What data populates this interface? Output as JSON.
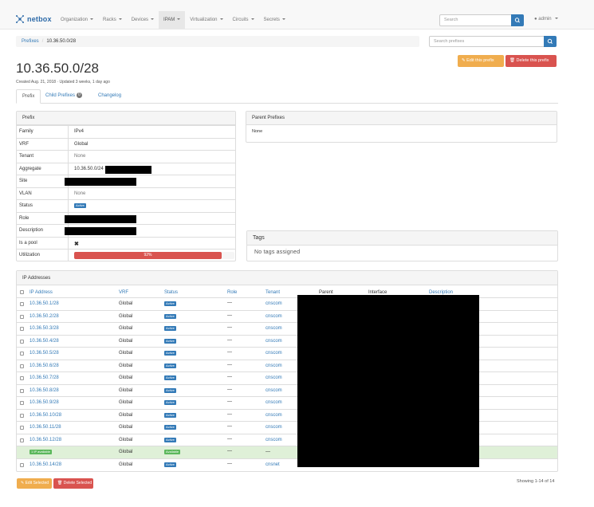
{
  "brand": {
    "name": "netbox"
  },
  "nav": {
    "items": [
      {
        "label": "Organization",
        "active": false
      },
      {
        "label": "Racks",
        "active": false
      },
      {
        "label": "Devices",
        "active": false
      },
      {
        "label": "IPAM",
        "active": true
      },
      {
        "label": "Virtualization",
        "active": false
      },
      {
        "label": "Circuits",
        "active": false
      },
      {
        "label": "Secrets",
        "active": false
      }
    ],
    "search_placeholder": "Search",
    "user": "admin"
  },
  "breadcrumb": {
    "parent": "Prefixes",
    "current": "10.36.50.0/28"
  },
  "prefix_search_placeholder": "Search prefixes",
  "actions": {
    "edit": "Edit this prefix",
    "delete": "Delete this prefix"
  },
  "title": "10.36.50.0/28",
  "created_text": "Created Aug. 21, 2018 · Updated 3 weeks, 1 day ago",
  "tabs": [
    {
      "label": "Prefix",
      "active": true
    },
    {
      "label": "Child Prefixes",
      "badge": "0",
      "active": false
    },
    {
      "label": "Changelog",
      "active": false
    }
  ],
  "prefix_panel": {
    "heading": "Prefix",
    "rows": {
      "family": {
        "key": "Family",
        "value": "IPv4"
      },
      "vrf": {
        "key": "VRF",
        "value": "Global"
      },
      "tenant": {
        "key": "Tenant",
        "value": "None"
      },
      "aggregate": {
        "key": "Aggregate",
        "value": "10.36.50.0/24"
      },
      "site": {
        "key": "Site"
      },
      "vlan": {
        "key": "VLAN",
        "value": "None"
      },
      "status": {
        "key": "Status",
        "value": "Active"
      },
      "role": {
        "key": "Role"
      },
      "description": {
        "key": "Description"
      },
      "is_pool": {
        "key": "Is a pool",
        "value": "✖"
      },
      "utilization": {
        "key": "Utilization",
        "value": "92%",
        "percent": 92
      }
    }
  },
  "parent_panel": {
    "heading": "Parent Prefixes",
    "empty": "None"
  },
  "tags_panel": {
    "heading": "Tags",
    "empty": "No tags assigned"
  },
  "ip_panel": {
    "heading": "IP Addresses",
    "columns": [
      "IP Address",
      "VRF",
      "Status",
      "Role",
      "Tenant",
      "Parent",
      "Interface",
      "Description"
    ],
    "rows": [
      {
        "ip": "10.36.50.1/28",
        "vrf": "Global",
        "status": "Active",
        "role": "—",
        "tenant": "cnscom",
        "available": false
      },
      {
        "ip": "10.36.50.2/28",
        "vrf": "Global",
        "status": "Active",
        "role": "—",
        "tenant": "cnscom",
        "available": false
      },
      {
        "ip": "10.36.50.3/28",
        "vrf": "Global",
        "status": "Active",
        "role": "—",
        "tenant": "cnscom",
        "available": false
      },
      {
        "ip": "10.36.50.4/28",
        "vrf": "Global",
        "status": "Active",
        "role": "—",
        "tenant": "cnscom",
        "available": false
      },
      {
        "ip": "10.36.50.5/28",
        "vrf": "Global",
        "status": "Active",
        "role": "—",
        "tenant": "cnscom",
        "available": false
      },
      {
        "ip": "10.36.50.6/28",
        "vrf": "Global",
        "status": "Active",
        "role": "—",
        "tenant": "cnscom",
        "available": false
      },
      {
        "ip": "10.36.50.7/28",
        "vrf": "Global",
        "status": "Active",
        "role": "—",
        "tenant": "cnscom",
        "available": false
      },
      {
        "ip": "10.36.50.8/28",
        "vrf": "Global",
        "status": "Active",
        "role": "—",
        "tenant": "cnscom",
        "available": false
      },
      {
        "ip": "10.36.50.9/28",
        "vrf": "Global",
        "status": "Active",
        "role": "—",
        "tenant": "cnscom",
        "available": false
      },
      {
        "ip": "10.36.50.10/28",
        "vrf": "Global",
        "status": "Active",
        "role": "—",
        "tenant": "cnscom",
        "available": false
      },
      {
        "ip": "10.36.50.11/28",
        "vrf": "Global",
        "status": "Active",
        "role": "—",
        "tenant": "cnscom",
        "available": false
      },
      {
        "ip": "10.36.50.12/28",
        "vrf": "Global",
        "status": "Active",
        "role": "—",
        "tenant": "cnscom",
        "available": false
      },
      {
        "ip": "1 IP available",
        "vrf": "Global",
        "status": "Available",
        "role": "—",
        "tenant": "—",
        "available": true
      },
      {
        "ip": "10.36.50.14/28",
        "vrf": "Global",
        "status": "Active",
        "role": "—",
        "tenant": "cnsnet",
        "available": false
      }
    ]
  },
  "bulk": {
    "edit": "Edit Selected",
    "delete": "Delete Selected"
  },
  "showing": "Showing 1-14 of 14",
  "colors": {
    "primary": "#337ab7",
    "danger": "#d9534f",
    "warning": "#f0ad4e",
    "success": "#5cb85c"
  }
}
